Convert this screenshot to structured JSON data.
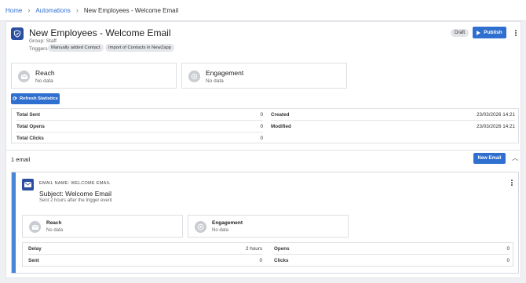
{
  "breadcrumb": {
    "home": "Home",
    "automations": "Automations",
    "current": "New Employees - Welcome Email"
  },
  "header": {
    "title": "New Employees - Welcome Email",
    "group": "Group: Staff",
    "triggers_label": "Triggers",
    "triggers": [
      "Manually added Contact",
      "Import of Contacts in NewZapp"
    ],
    "status": "Draft",
    "publish_label": "Publish"
  },
  "stats": {
    "reach": {
      "title": "Reach",
      "value": "No data"
    },
    "engagement": {
      "title": "Engagement",
      "value": "No data"
    },
    "refresh_label": "Refresh Statistics"
  },
  "totals": {
    "left": [
      {
        "label": "Total Sent",
        "value": "0"
      },
      {
        "label": "Total Opens",
        "value": "0"
      },
      {
        "label": "Total Clicks",
        "value": "0"
      }
    ],
    "right": [
      {
        "label": "Created",
        "value": "23/03/2026 14:21"
      },
      {
        "label": "Modified",
        "value": "23/03/2026 14:21"
      }
    ]
  },
  "emails": {
    "count_label": "1 email",
    "new_email_label": "New Email",
    "items": [
      {
        "name_label": "EMAIL NAME: WELCOME EMAIL",
        "subject": "Subject: Welcome Email",
        "sent_info": "Sent 2 hours after the trigger event",
        "reach": {
          "title": "Reach",
          "value": "No data"
        },
        "engagement": {
          "title": "Engagement",
          "value": "No data"
        },
        "details_left": [
          {
            "label": "Delay",
            "value": "2 hours"
          },
          {
            "label": "Sent",
            "value": "0"
          }
        ],
        "details_right": [
          {
            "label": "Opens",
            "value": "0"
          },
          {
            "label": "Clicks",
            "value": "0"
          }
        ]
      }
    ]
  },
  "colors": {
    "primary": "#2f6fcf",
    "icon_bg": "#2b4fa0",
    "email_accent": "#4a86d8",
    "page_bg": "#eef0f3"
  }
}
